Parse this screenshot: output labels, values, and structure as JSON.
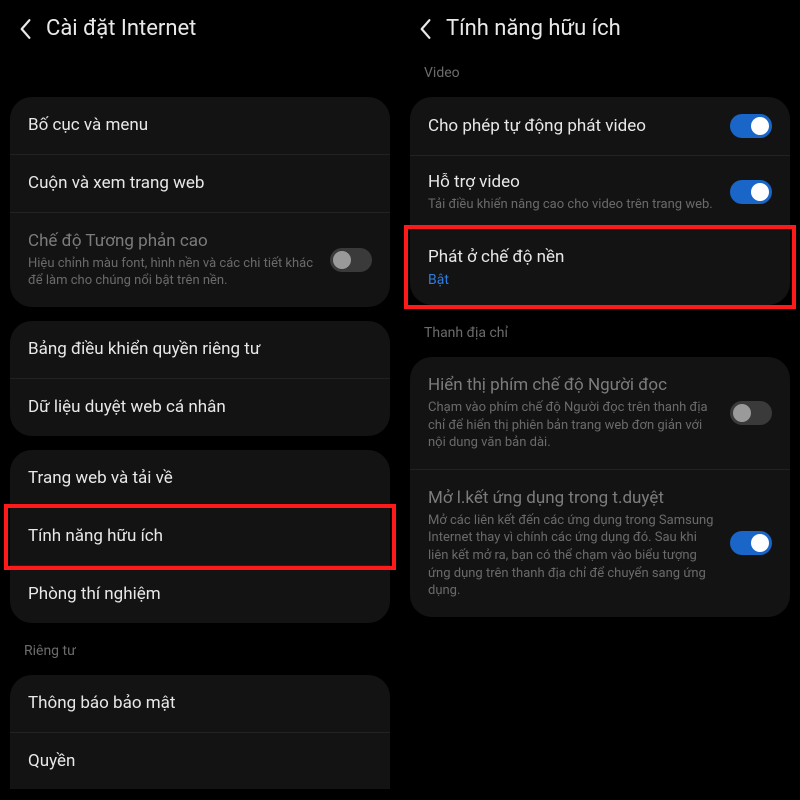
{
  "left": {
    "header_title": "Cài đặt Internet",
    "groups": [
      {
        "items": [
          {
            "title": "Bố cục và menu"
          },
          {
            "title": "Cuộn và xem trang web"
          },
          {
            "title": "Chế độ Tương phản cao",
            "sub": "Hiệu chỉnh màu font, hình nền và các chi tiết khác để làm cho chúng nổi bật trên nền.",
            "dimmed": true,
            "toggle": "off"
          }
        ]
      },
      {
        "items": [
          {
            "title": "Bảng điều khiển quyền riêng tư"
          },
          {
            "title": "Dữ liệu duyệt web cá nhân"
          }
        ]
      },
      {
        "items": [
          {
            "title": "Trang web và tải về"
          },
          {
            "title": "Tính năng hữu ích",
            "highlighted": true
          },
          {
            "title": "Phòng thí nghiệm"
          }
        ]
      }
    ],
    "section_label": "Riêng tư",
    "privacy_group": {
      "items": [
        {
          "title": "Thông báo bảo mật"
        },
        {
          "title": "Quyền"
        }
      ]
    }
  },
  "right": {
    "header_title": "Tính năng hữu ích",
    "section_video": "Video",
    "video_group": {
      "items": [
        {
          "title": "Cho phép tự động phát video",
          "toggle": "on"
        },
        {
          "title": "Hỗ trợ video",
          "sub": "Tải điều khiển nâng cao cho video trên trang web.",
          "toggle": "on"
        },
        {
          "title": "Phát ở chế độ nền",
          "value_on": "Bật",
          "highlighted": true
        }
      ]
    },
    "section_address": "Thanh địa chỉ",
    "address_group": {
      "items": [
        {
          "title": "Hiển thị phím chế độ Người đọc",
          "sub": "Chạm vào phím chế độ Người đọc trên thanh địa chỉ để hiển thị phiên bản trang web đơn giản với nội dung văn bản dài.",
          "dimmed": true,
          "toggle": "off"
        },
        {
          "title": "Mở l.kết ứng dụng trong t.duyệt",
          "sub": "Mở các liên kết đến các ứng dụng trong Samsung Internet thay vì chính các ứng dụng đó. Sau khi liên kết mở ra, bạn có thể chạm vào biểu tượng ứng dụng trên thanh địa chỉ để chuyển sang ứng dụng.",
          "dimmed": true,
          "toggle": "on"
        }
      ]
    }
  }
}
